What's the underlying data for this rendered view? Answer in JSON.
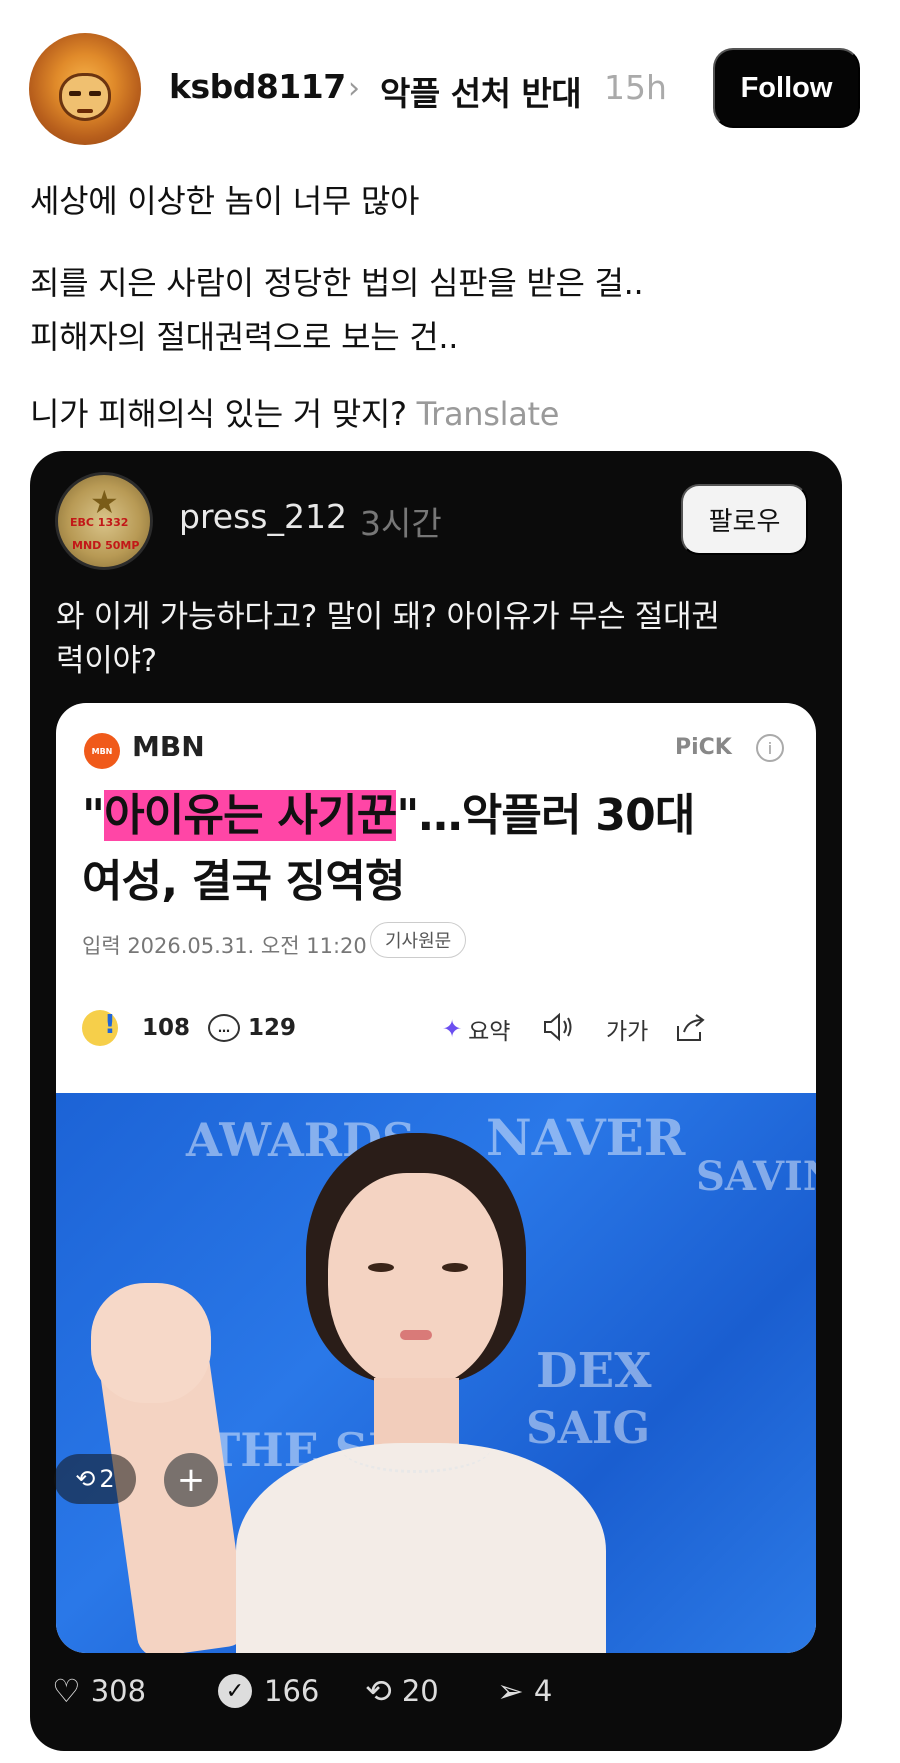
{
  "post": {
    "username": "ksbd8117",
    "topic": "악플 선처 반대",
    "time": "15h",
    "follow_label": "Follow",
    "lines": [
      "세상에 이상한 놈이 너무 많아",
      "죄를 지은 사람이 정당한 법의 심판을 받은 걸..",
      "피해자의 절대권력으로 보는 건..",
      "니가 피해의식 있는 거 맞지?"
    ],
    "translate_label": "Translate"
  },
  "quote": {
    "username": "press_212",
    "time": "3시간",
    "follow_label": "팔로우",
    "text_line1": "와 이게 가능하다고? 말이 돼? 아이유가 무슨 절대권",
    "text_line2": "력이야?",
    "avatar_text1": "EBC 1332",
    "avatar_text2": "MND 50MP",
    "stats": {
      "likes": "308",
      "replies": "166",
      "reposts": "20",
      "shares": "4"
    }
  },
  "news": {
    "source_logo": "MBN",
    "source": "MBN",
    "pick": "PiCK",
    "headline_open_quote": "\"",
    "headline_highlight": "아이유는 사기꾼",
    "headline_rest_line1": "\"…악플러 30대",
    "headline_line2": "여성, 결국 징역형",
    "meta": "입력 2026.05.31. 오전 11:20",
    "meta_chip": "기사원문",
    "reactions": "108",
    "comments": "129",
    "summary_label": "요약",
    "font_label": "가가",
    "photo_bg_text": [
      "AWARDS",
      "NAVER",
      "SAVING",
      "THE SEV",
      "DEX",
      "SAIG"
    ],
    "overlay_repost_count": "2",
    "highlight_color": "#ff46a6"
  }
}
